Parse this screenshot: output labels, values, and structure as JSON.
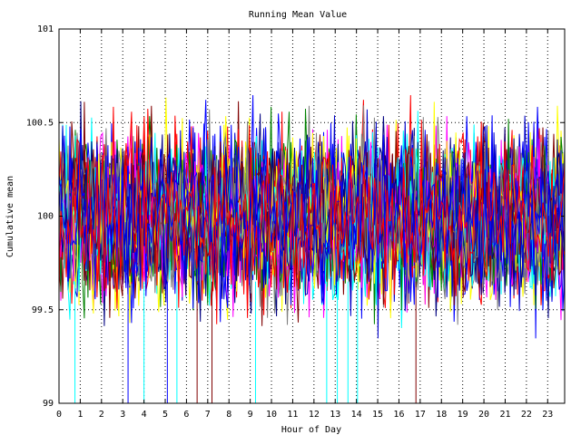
{
  "chart_data": {
    "type": "line",
    "title": "Running Mean Value",
    "xlabel": "Hour of Day",
    "ylabel": "Cumulative mean",
    "xlim": [
      0,
      23.8
    ],
    "ylim": [
      99,
      101
    ],
    "x_ticks": [
      0,
      1,
      2,
      3,
      4,
      5,
      6,
      7,
      8,
      9,
      10,
      11,
      12,
      13,
      14,
      15,
      16,
      17,
      18,
      19,
      20,
      21,
      22,
      23
    ],
    "y_ticks": [
      99,
      99.5,
      100,
      100.5,
      101
    ],
    "y_tick_labels": [
      "99",
      "99.5",
      "100",
      "100.5",
      "101"
    ],
    "grid": true,
    "legend": "none",
    "center": 100,
    "series_count": 32,
    "points_per_series": 280,
    "typical_spread": 0.22,
    "colors": [
      "#0000ff",
      "#ff0000",
      "#008000",
      "#ff00ff",
      "#00ffff",
      "#ffff00",
      "#000080",
      "#800000",
      "#808080",
      "#0000cc"
    ],
    "drops_to_floor": [
      {
        "x": 0.75,
        "color": "#00ffff"
      },
      {
        "x": 3.25,
        "color": "#0000ff"
      },
      {
        "x": 4.0,
        "color": "#00ffff"
      },
      {
        "x": 5.1,
        "color": "#0000ff"
      },
      {
        "x": 5.55,
        "color": "#00ffff"
      },
      {
        "x": 6.5,
        "color": "#800000"
      },
      {
        "x": 7.2,
        "color": "#800000"
      },
      {
        "x": 9.25,
        "color": "#00ffff"
      },
      {
        "x": 12.6,
        "color": "#00ffff"
      },
      {
        "x": 13.1,
        "color": "#00ffff"
      },
      {
        "x": 13.6,
        "color": "#00ffff"
      },
      {
        "x": 14.05,
        "color": "#00ffff"
      },
      {
        "x": 16.8,
        "color": "#800000"
      }
    ]
  }
}
